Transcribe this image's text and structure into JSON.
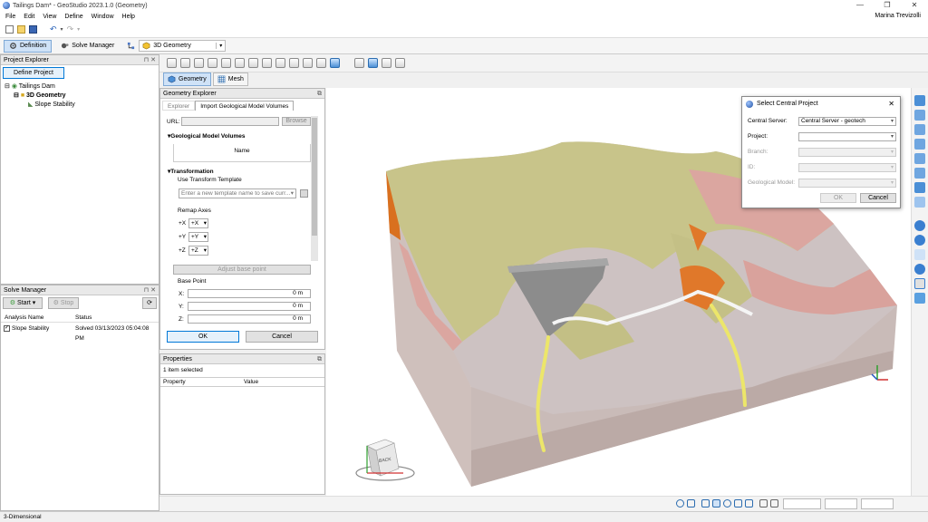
{
  "window": {
    "title": "Tailings Dam* - GeoStudio 2023.1.0 (Geometry)",
    "controls": [
      "—",
      "❐",
      "✕"
    ]
  },
  "menu": {
    "items": [
      "File",
      "Edit",
      "View",
      "Define",
      "Window",
      "Help"
    ],
    "user": "Marina Trevizolli"
  },
  "tabs": {
    "definition": "Definition",
    "solve_manager": "Solve Manager",
    "geometry_select": "3D Geometry"
  },
  "project_explorer": {
    "title": "Project Explorer",
    "define_project": "Define Project",
    "tree": {
      "root": "Tailings Dam",
      "child": "3D Geometry",
      "leaf": "Slope Stability"
    }
  },
  "solve_manager": {
    "title": "Solve Manager",
    "start": "Start",
    "stop": "Stop",
    "col_name": "Analysis Name",
    "col_status": "Status",
    "row": {
      "name": "Slope Stability",
      "status": "Solved 03/13/2023 05:04:08 PM"
    }
  },
  "geometry_view_tabs": {
    "geometry": "Geometry",
    "mesh": "Mesh"
  },
  "geometry_explorer": {
    "title": "Geometry Explorer",
    "tab_explorer": "Explorer",
    "tab_import": "Import Geological Model Volumes",
    "url_label": "URL:",
    "browse": "Browse",
    "gmv_header": "Geological Model Volumes",
    "name_col": "Name",
    "transformation": "Transformation",
    "use_template": "Use Transform Template",
    "template_placeholder": "Enter a new template name to save curr...",
    "remap_axes": "Remap Axes",
    "axes": [
      {
        "label": "+X",
        "value": "+X"
      },
      {
        "label": "+Y",
        "value": "+Y"
      },
      {
        "label": "+Z",
        "value": "+Z"
      }
    ],
    "adjust_base_point": "Adjust base point",
    "base_point": "Base Point",
    "coords": [
      {
        "label": "X:",
        "value": "0 m"
      },
      {
        "label": "Y:",
        "value": "0 m"
      },
      {
        "label": "Z:",
        "value": "0 m"
      }
    ],
    "ok": "OK",
    "cancel": "Cancel"
  },
  "properties": {
    "title": "Properties",
    "selection": "1 item selected",
    "col_property": "Property",
    "col_value": "Value"
  },
  "dialog": {
    "title": "Select Central Project",
    "fields": [
      {
        "label": "Central Server:",
        "value": "Central Server - geotech",
        "enabled": true
      },
      {
        "label": "Project:",
        "value": "",
        "enabled": true
      },
      {
        "label": "Branch:",
        "value": "",
        "enabled": false
      },
      {
        "label": "ID:",
        "value": "",
        "enabled": false
      },
      {
        "label": "Geological Model:",
        "value": "",
        "enabled": false
      }
    ],
    "ok": "OK",
    "cancel": "Cancel"
  },
  "viewcube": {
    "face": "BACK"
  },
  "status": {
    "text": "3-Dimensional"
  },
  "colors": {
    "terrain_olive": "#c8c48a",
    "terrain_pink": "#dba6a0",
    "terrain_orange": "#e0782a",
    "terrain_gray": "#cfc6c6",
    "tailings_gray": "#8c8c8c",
    "road_yellow": "#ece66a",
    "accent_blue": "#0078d7"
  }
}
